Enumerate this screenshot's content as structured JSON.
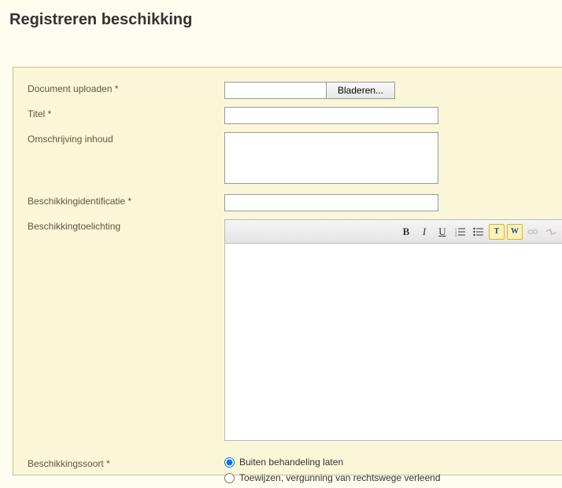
{
  "page": {
    "title": "Registreren beschikking"
  },
  "labels": {
    "document_upload": "Document uploaden *",
    "titel": "Titel *",
    "omschrijving": "Omschrijving inhoud",
    "identificatie": "Beschikkingidentificatie *",
    "toelichting": "Beschikkingtoelichting",
    "soort": "Beschikkingssoort *"
  },
  "file": {
    "value": "",
    "browse_label": "Bladeren..."
  },
  "fields": {
    "titel": "",
    "omschrijving": "",
    "identificatie": "",
    "toelichting": ""
  },
  "toolbar": {
    "bold": "B",
    "italic": "I",
    "underline": "U",
    "paste_text": "T",
    "paste_word": "W"
  },
  "soort": {
    "options": [
      {
        "label": "Buiten behandeling laten",
        "checked": true
      },
      {
        "label": "Toewijzen, vergunning van rechtswege verleend",
        "checked": false
      }
    ]
  }
}
